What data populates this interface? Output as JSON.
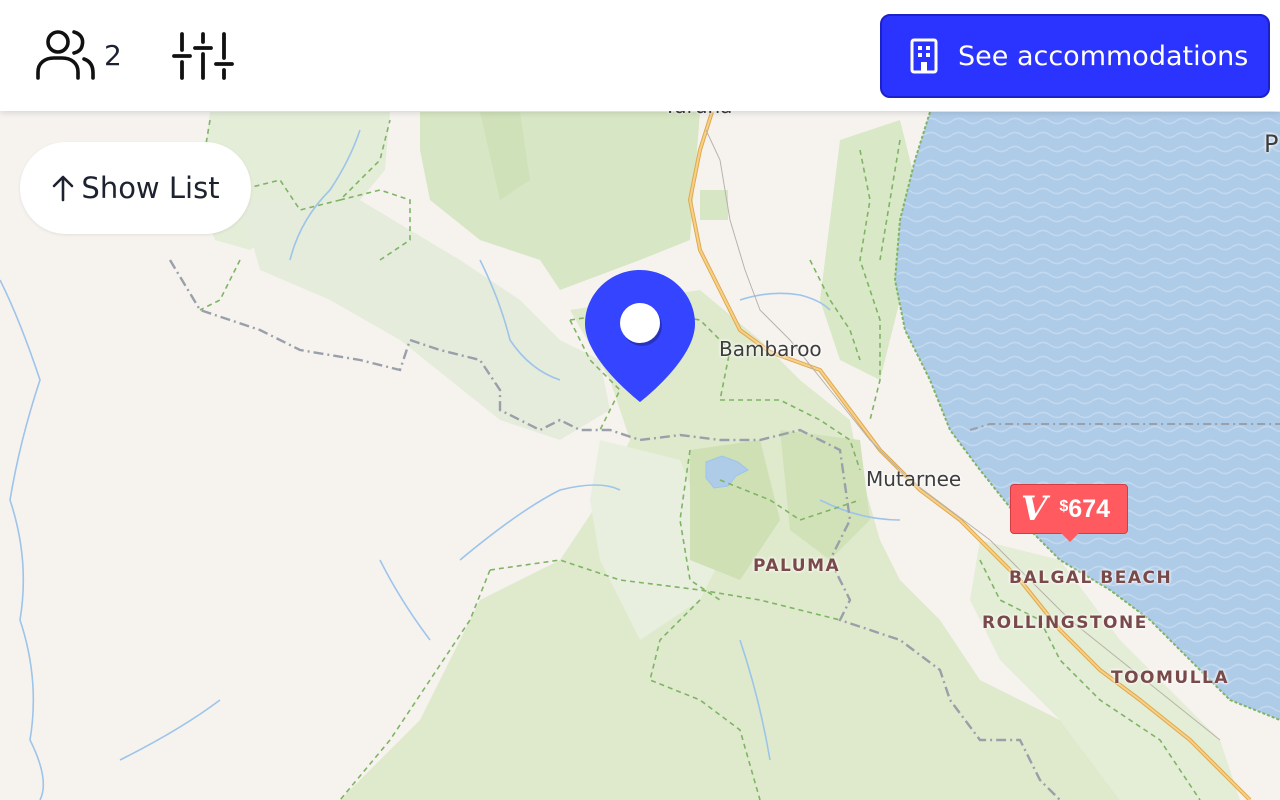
{
  "header": {
    "guests_icon": "users-icon",
    "guest_count": "2",
    "filters_icon": "sliders-icon",
    "accommodations_icon": "building-icon",
    "accommodations_label": "See accommodations"
  },
  "show_list": {
    "icon": "arrow-up-icon",
    "label": "Show List"
  },
  "map": {
    "places": [
      "Bambaroo",
      "Mutarnee"
    ],
    "partial_top_label": "Yuruna",
    "partial_edge_label": "P",
    "localities": [
      "PALUMA",
      "BALGAL BEACH",
      "ROLLINGSTONE",
      "TOOMULLA"
    ],
    "price_marker": {
      "logo": "V",
      "currency": "$",
      "amount": "674"
    },
    "location_pin_icon": "map-pin-icon",
    "colors": {
      "land": "#f6f3ef",
      "park": "#dde9cc",
      "water": "#aecbe8",
      "road": "#f0c070",
      "pin": "#3444ff",
      "price_marker": "#ff5a5f",
      "button": "#2b33ff"
    }
  }
}
